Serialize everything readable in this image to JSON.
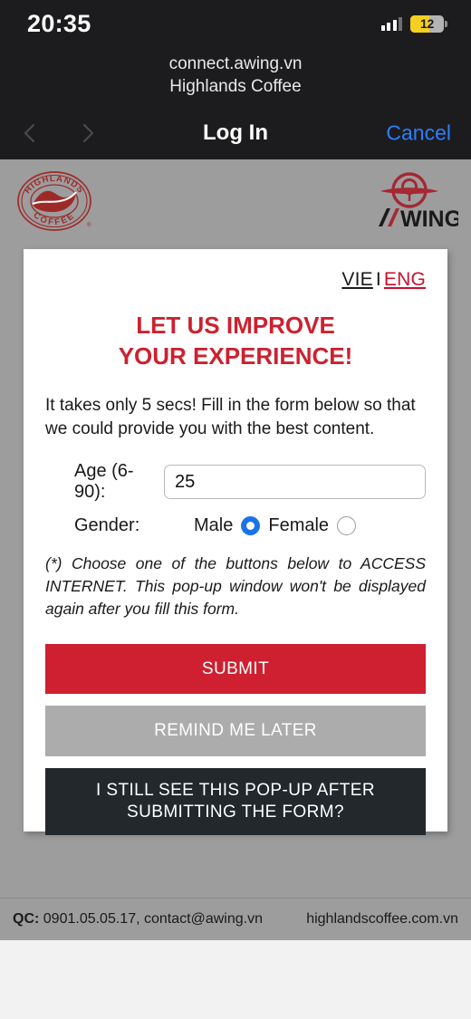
{
  "status_bar": {
    "time": "20:35",
    "signal_icon": "cellular-signal-icon",
    "battery_level": "12",
    "battery_icon": "battery-low-power-icon"
  },
  "browser": {
    "url_host": "connect.awing.vn",
    "url_subtitle": "Highlands Coffee",
    "nav_title": "Log In",
    "cancel_label": "Cancel",
    "back_icon": "chevron-left-icon",
    "forward_icon": "chevron-right-icon"
  },
  "brand": {
    "highlands_logo": "highlands-coffee-logo",
    "highlands_top_text": "HIGHLANDS",
    "highlands_bottom_text": "COFFEE",
    "awing_logo": "awing-logo",
    "awing_wordmark": "WING"
  },
  "card": {
    "language": {
      "vie": "VIE",
      "separator": "I",
      "eng": "ENG"
    },
    "headline_line1": "LET US IMPROVE",
    "headline_line2": "YOUR EXPERIENCE!",
    "intro": "It takes only 5 secs! Fill in the form below so that we could provide you with the best content.",
    "form": {
      "age_label": "Age (6-90):",
      "age_value": "25",
      "age_placeholder": "",
      "gender_label": "Gender:",
      "male_label": "Male",
      "female_label": "Female",
      "selected_gender": "Male"
    },
    "note": "(*) Choose one of the buttons below to ACCESS INTERNET. This pop-up window won't be displayed again after you fill this form.",
    "buttons": {
      "submit": "SUBMIT",
      "remind": "REMIND ME LATER",
      "popup_line1": "I STILL SEE THIS POP-UP AFTER",
      "popup_line2": "SUBMITTING THE FORM?"
    }
  },
  "footer": {
    "qc_label": "QC:",
    "qc_contact": " 0901.05.05.17, contact@awing.vn",
    "website": "highlandscoffee.com.vn"
  },
  "colors": {
    "brand_red": "#cc2130",
    "submit_red": "#ce2030",
    "remind_gray": "#acacac",
    "popup_dark": "#22282c",
    "page_gray": "#9d9d9d",
    "radio_blue": "#1a73e8",
    "cancel_blue": "#2b7fff"
  }
}
